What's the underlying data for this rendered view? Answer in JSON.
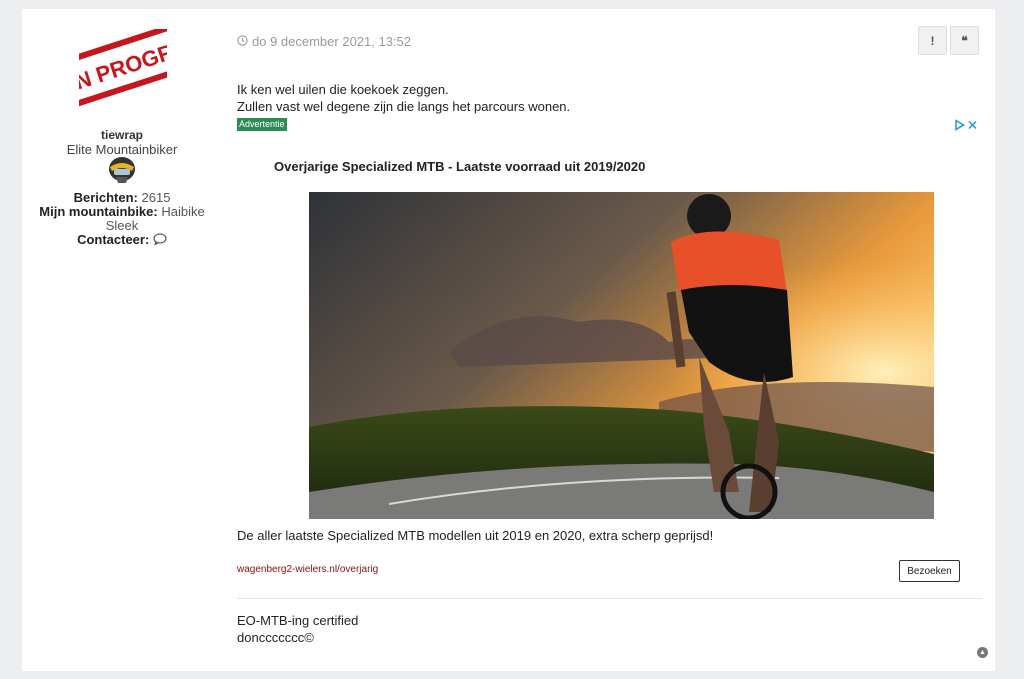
{
  "profile": {
    "avatar_text": "N PROGRES",
    "username": "tiewrap",
    "rank": "Elite Mountainbiker",
    "posts_label": "Berichten:",
    "posts_value": "2615",
    "bike_label": "Mijn mountainbike:",
    "bike_value_1": "Haibike",
    "bike_value_2": "Sleek",
    "contact_label": "Contacteer:"
  },
  "post": {
    "date": "do 9 december 2021, 13:52",
    "report_icon": "!",
    "quote_icon": "❝",
    "line1": "Ik ken wel uilen die koekoek zeggen.",
    "line2": "Zullen vast wel degene zijn die langs het parcours wonen."
  },
  "ad": {
    "badge": "Advertentie",
    "title": "Overjarige Specialized MTB - Laatste voorraad uit 2019/2020",
    "description": "De aller laatste Specialized MTB modellen uit 2019 en 2020, extra scherp geprijsd!",
    "link": "wagenberg2-wielers.nl/overjarig",
    "visit_label": "Bezoeken"
  },
  "signature": {
    "line1": "EO-MTB-ing certified",
    "line2": "donccccccc©"
  },
  "colors": {
    "ad_badge": "#2e8b57",
    "ad_link": "#8b1010",
    "ad_choices": "#1a9ddb"
  }
}
